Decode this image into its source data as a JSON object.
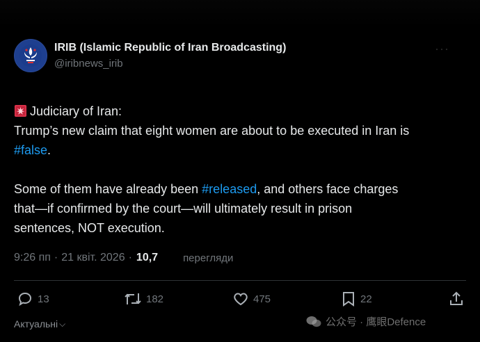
{
  "author": {
    "display_name": "IRIB (Islamic Republic of Iran Broadcasting)",
    "handle": "@iribnews_irib",
    "avatar_icon": "irib-logo-icon"
  },
  "post": {
    "line1_prefix_icon": "rotating-light-icon",
    "line1": "Judiciary of Iran:",
    "line2": "Trump’s new claim that eight women are about to be executed in Iran is",
    "hashtag1": "#false",
    "hashtag1_suffix": ".",
    "para2_start": "Some of them have already been ",
    "hashtag2": "#released",
    "para2_mid": ", and others face charges",
    "para2_line2": "that—if confirmed by the court—will ultimately result in prison",
    "para2_line3": "sentences, NOT execution."
  },
  "meta": {
    "time": "9:26 пп",
    "separator": "·",
    "date": "21 квіт. 2026",
    "views_count": "10,7",
    "views_label": "перегляди"
  },
  "actions": {
    "replies": "13",
    "reposts": "182",
    "likes": "475",
    "bookmarks": "22"
  },
  "footer": {
    "sort_label": "Актуальні"
  },
  "watermark": {
    "text": "公众号 · 鹰眼Defence"
  },
  "colors": {
    "background": "#000000",
    "text": "#e7e9ea",
    "secondary": "#71767b",
    "hashtag": "#1d9bf0",
    "divider": "#2f3336"
  }
}
